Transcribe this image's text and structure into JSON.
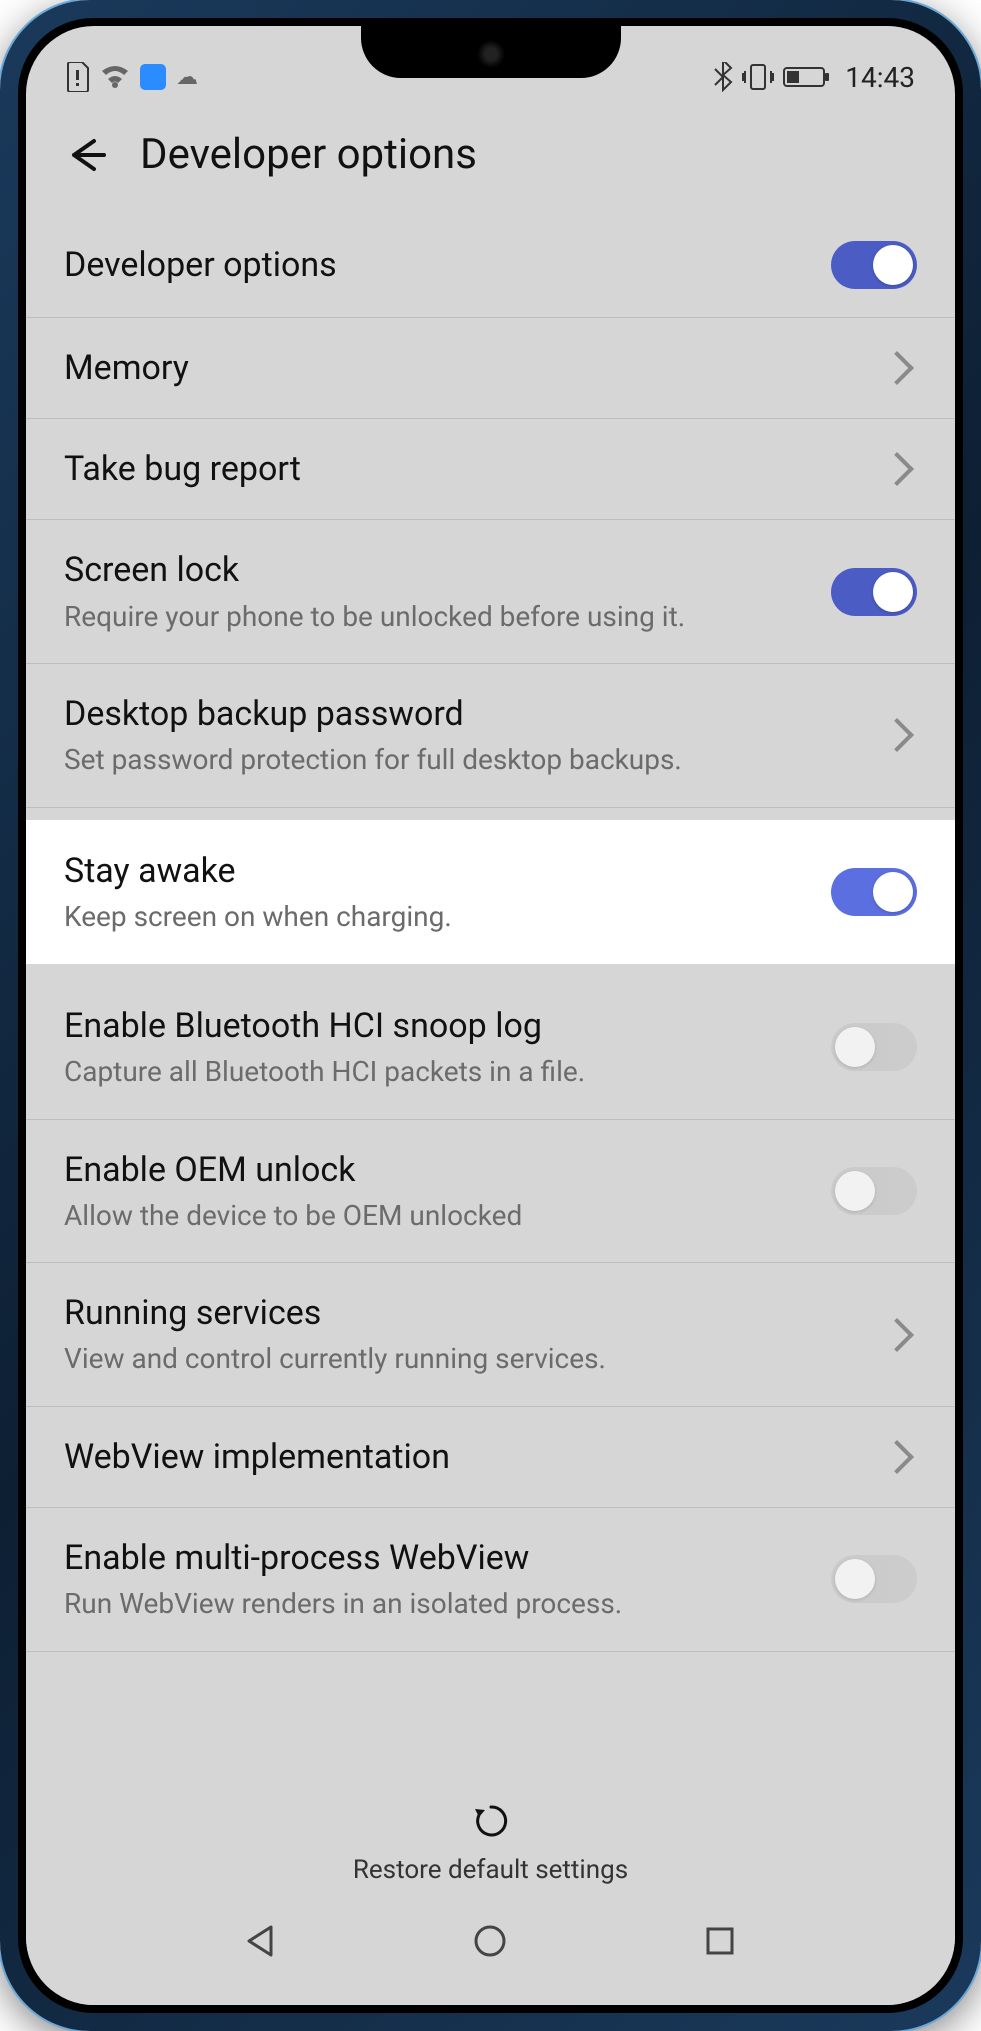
{
  "status": {
    "time": "14:43"
  },
  "header": {
    "title": "Developer options"
  },
  "rows": {
    "dev_options": {
      "title": "Developer options"
    },
    "memory": {
      "title": "Memory"
    },
    "bug_report": {
      "title": "Take bug report"
    },
    "screen_lock": {
      "title": "Screen lock",
      "sub": "Require your phone to be unlocked before using it."
    },
    "desktop_backup": {
      "title": "Desktop backup password",
      "sub": "Set password protection for full desktop backups."
    },
    "stay_awake": {
      "title": "Stay awake",
      "sub": "Keep screen on when charging."
    },
    "bt_snoop": {
      "title": "Enable Bluetooth HCI snoop log",
      "sub": "Capture all Bluetooth HCI packets in a file."
    },
    "oem_unlock": {
      "title": "Enable OEM unlock",
      "sub": "Allow the device to be OEM unlocked"
    },
    "running_services": {
      "title": "Running services",
      "sub": "View and control currently running services."
    },
    "webview_impl": {
      "title": "WebView implementation"
    },
    "multi_webview": {
      "title": "Enable multi-process WebView",
      "sub": "Run WebView renders in an isolated process."
    }
  },
  "bottom": {
    "restore": "Restore default settings"
  }
}
